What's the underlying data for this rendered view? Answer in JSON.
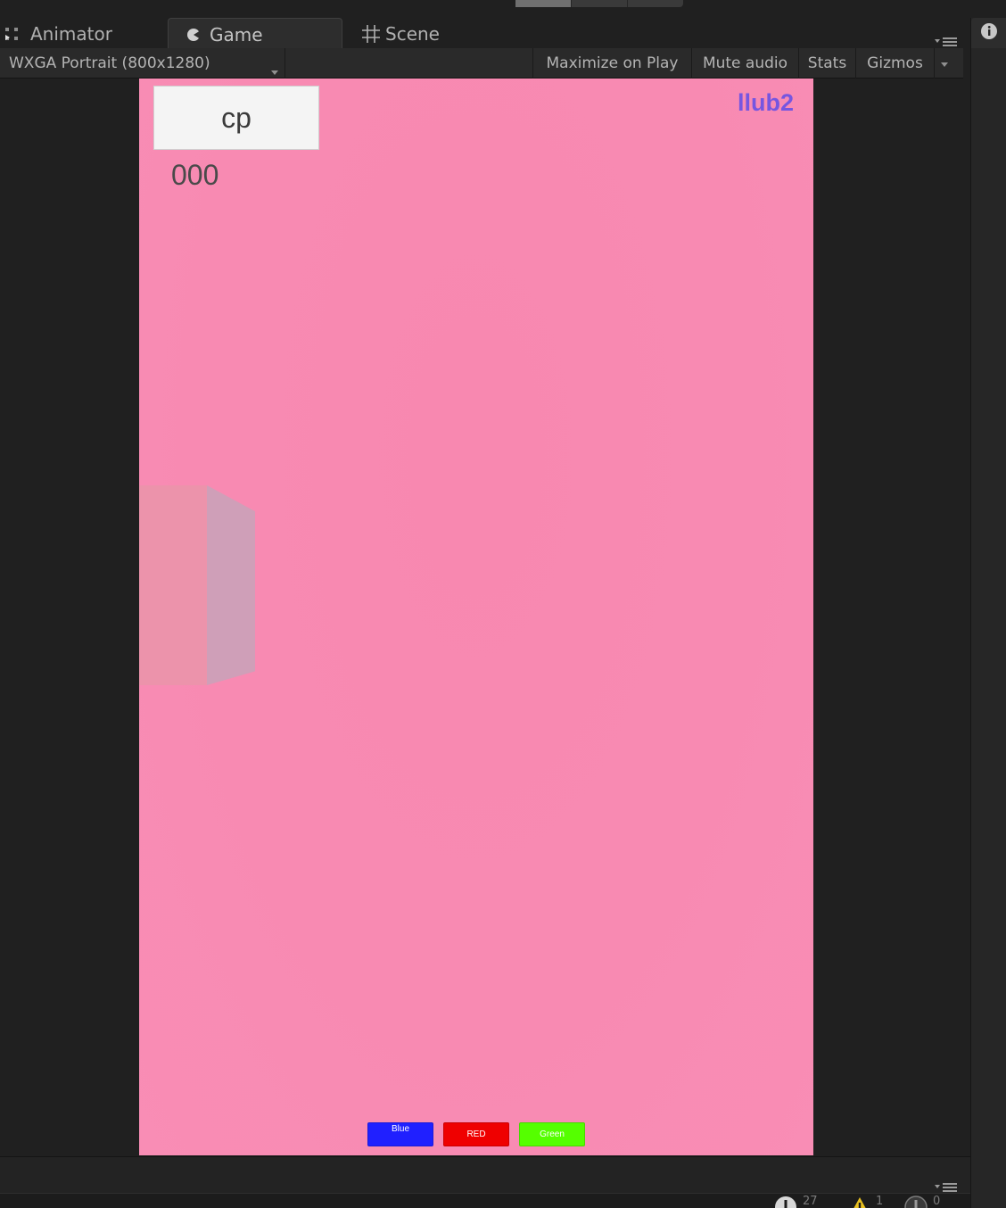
{
  "tabs": {
    "animator": "Animator",
    "game": "Game",
    "scene": "Scene"
  },
  "toolbar": {
    "resolution": "WXGA Portrait (800x1280)",
    "maximize_on_play": "Maximize on Play",
    "mute_audio": "Mute audio",
    "stats": "Stats",
    "gizmos": "Gizmos"
  },
  "game": {
    "cp_label": "cp",
    "score": "000",
    "level": "llub2",
    "buttons": {
      "blue": "Blue",
      "red": "RED",
      "green": "Green"
    }
  },
  "console": {
    "info_count": "27",
    "warn_count": "1",
    "error_count": "0"
  },
  "colors": {
    "background": "#f88ab2",
    "blue_button": "#2020ff",
    "red_button": "#ef0000",
    "green_button": "#55ff00",
    "level_text": "#7656e0"
  },
  "icons": [
    "animator-icon",
    "game-icon",
    "scene-grid-icon",
    "pane-menu-icon",
    "info-icon",
    "dropdown-caret-icon",
    "console-info-icon",
    "console-warning-icon",
    "console-error-icon"
  ]
}
